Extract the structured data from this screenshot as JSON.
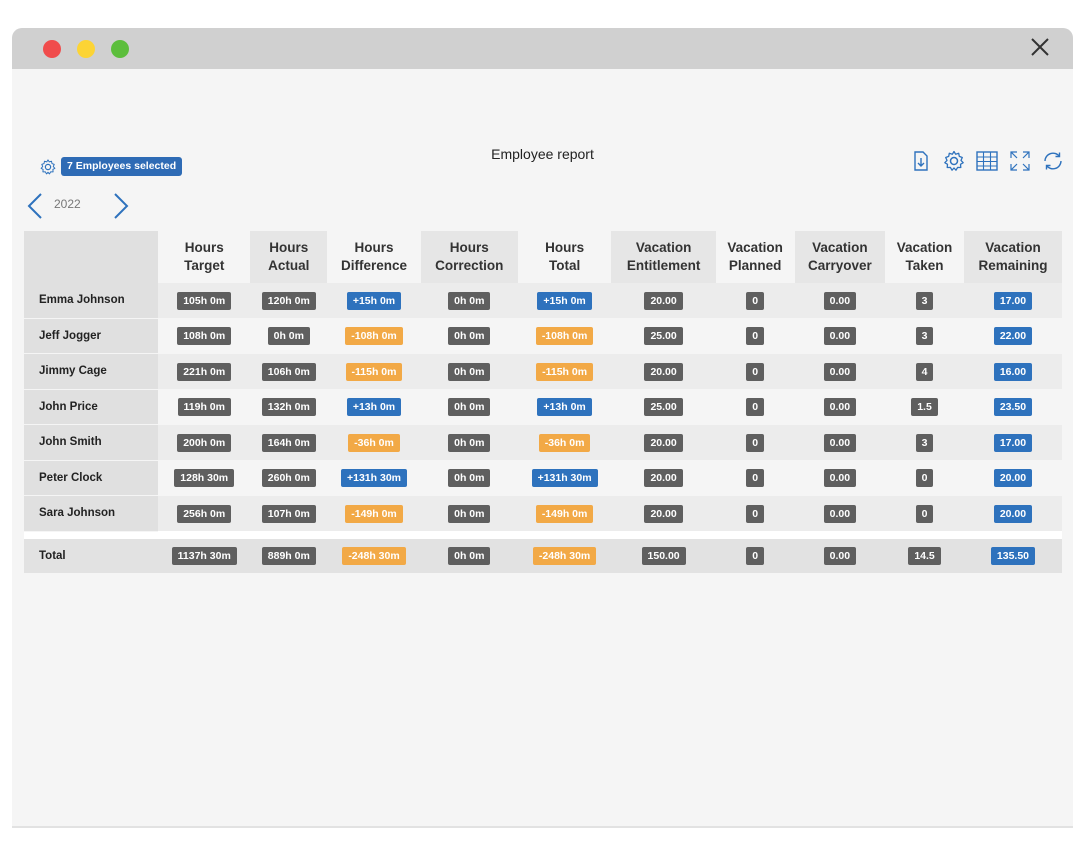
{
  "window": {
    "close_label": "close"
  },
  "header": {
    "title": "Employee report",
    "selection_badge": "7 Employees selected",
    "year": "2022",
    "toolbar": [
      "export-icon",
      "settings-icon",
      "table-view-icon",
      "fullscreen-icon",
      "refresh-icon"
    ]
  },
  "colors": {
    "gray": "#5f5f5f",
    "blue": "#2e72bd",
    "orange": "#f2a946",
    "accent": "#2e6bb5"
  },
  "table": {
    "columns": [
      {
        "l1": "Hours",
        "l2": "Target"
      },
      {
        "l1": "Hours",
        "l2": "Actual"
      },
      {
        "l1": "Hours",
        "l2": "Difference"
      },
      {
        "l1": "Hours",
        "l2": "Correction"
      },
      {
        "l1": "Hours",
        "l2": "Total"
      },
      {
        "l1": "Vacation",
        "l2": "Entitlement"
      },
      {
        "l1": "Vacation",
        "l2": "Planned"
      },
      {
        "l1": "Vacation",
        "l2": "Carryover"
      },
      {
        "l1": "Vacation",
        "l2": "Taken"
      },
      {
        "l1": "Vacation",
        "l2": "Remaining"
      }
    ],
    "rows": [
      {
        "name": "Emma Johnson",
        "cells": [
          {
            "v": "105h 0m",
            "c": "gray"
          },
          {
            "v": "120h 0m",
            "c": "gray"
          },
          {
            "v": "+15h 0m",
            "c": "blue"
          },
          {
            "v": "0h 0m",
            "c": "gray"
          },
          {
            "v": "+15h 0m",
            "c": "blue"
          },
          {
            "v": "20.00",
            "c": "gray"
          },
          {
            "v": "0",
            "c": "gray"
          },
          {
            "v": "0.00",
            "c": "gray"
          },
          {
            "v": "3",
            "c": "gray"
          },
          {
            "v": "17.00",
            "c": "blue"
          }
        ]
      },
      {
        "name": "Jeff Jogger",
        "cells": [
          {
            "v": "108h 0m",
            "c": "gray"
          },
          {
            "v": "0h 0m",
            "c": "gray"
          },
          {
            "v": "-108h 0m",
            "c": "orange"
          },
          {
            "v": "0h 0m",
            "c": "gray"
          },
          {
            "v": "-108h 0m",
            "c": "orange"
          },
          {
            "v": "25.00",
            "c": "gray"
          },
          {
            "v": "0",
            "c": "gray"
          },
          {
            "v": "0.00",
            "c": "gray"
          },
          {
            "v": "3",
            "c": "gray"
          },
          {
            "v": "22.00",
            "c": "blue"
          }
        ]
      },
      {
        "name": "Jimmy Cage",
        "cells": [
          {
            "v": "221h 0m",
            "c": "gray"
          },
          {
            "v": "106h 0m",
            "c": "gray"
          },
          {
            "v": "-115h 0m",
            "c": "orange"
          },
          {
            "v": "0h 0m",
            "c": "gray"
          },
          {
            "v": "-115h 0m",
            "c": "orange"
          },
          {
            "v": "20.00",
            "c": "gray"
          },
          {
            "v": "0",
            "c": "gray"
          },
          {
            "v": "0.00",
            "c": "gray"
          },
          {
            "v": "4",
            "c": "gray"
          },
          {
            "v": "16.00",
            "c": "blue"
          }
        ]
      },
      {
        "name": "John Price",
        "cells": [
          {
            "v": "119h 0m",
            "c": "gray"
          },
          {
            "v": "132h 0m",
            "c": "gray"
          },
          {
            "v": "+13h 0m",
            "c": "blue"
          },
          {
            "v": "0h 0m",
            "c": "gray"
          },
          {
            "v": "+13h 0m",
            "c": "blue"
          },
          {
            "v": "25.00",
            "c": "gray"
          },
          {
            "v": "0",
            "c": "gray"
          },
          {
            "v": "0.00",
            "c": "gray"
          },
          {
            "v": "1.5",
            "c": "gray"
          },
          {
            "v": "23.50",
            "c": "blue"
          }
        ]
      },
      {
        "name": "John Smith",
        "cells": [
          {
            "v": "200h 0m",
            "c": "gray"
          },
          {
            "v": "164h 0m",
            "c": "gray"
          },
          {
            "v": "-36h 0m",
            "c": "orange"
          },
          {
            "v": "0h 0m",
            "c": "gray"
          },
          {
            "v": "-36h 0m",
            "c": "orange"
          },
          {
            "v": "20.00",
            "c": "gray"
          },
          {
            "v": "0",
            "c": "gray"
          },
          {
            "v": "0.00",
            "c": "gray"
          },
          {
            "v": "3",
            "c": "gray"
          },
          {
            "v": "17.00",
            "c": "blue"
          }
        ]
      },
      {
        "name": "Peter Clock",
        "cells": [
          {
            "v": "128h 30m",
            "c": "gray"
          },
          {
            "v": "260h 0m",
            "c": "gray"
          },
          {
            "v": "+131h 30m",
            "c": "blue"
          },
          {
            "v": "0h 0m",
            "c": "gray"
          },
          {
            "v": "+131h 30m",
            "c": "blue"
          },
          {
            "v": "20.00",
            "c": "gray"
          },
          {
            "v": "0",
            "c": "gray"
          },
          {
            "v": "0.00",
            "c": "gray"
          },
          {
            "v": "0",
            "c": "gray"
          },
          {
            "v": "20.00",
            "c": "blue"
          }
        ]
      },
      {
        "name": "Sara Johnson",
        "cells": [
          {
            "v": "256h 0m",
            "c": "gray"
          },
          {
            "v": "107h 0m",
            "c": "gray"
          },
          {
            "v": "-149h 0m",
            "c": "orange"
          },
          {
            "v": "0h 0m",
            "c": "gray"
          },
          {
            "v": "-149h 0m",
            "c": "orange"
          },
          {
            "v": "20.00",
            "c": "gray"
          },
          {
            "v": "0",
            "c": "gray"
          },
          {
            "v": "0.00",
            "c": "gray"
          },
          {
            "v": "0",
            "c": "gray"
          },
          {
            "v": "20.00",
            "c": "blue"
          }
        ]
      }
    ],
    "total": {
      "name": "Total",
      "cells": [
        {
          "v": "1137h 30m",
          "c": "gray"
        },
        {
          "v": "889h 0m",
          "c": "gray"
        },
        {
          "v": "-248h 30m",
          "c": "orange"
        },
        {
          "v": "0h 0m",
          "c": "gray"
        },
        {
          "v": "-248h 30m",
          "c": "orange"
        },
        {
          "v": "150.00",
          "c": "gray"
        },
        {
          "v": "0",
          "c": "gray"
        },
        {
          "v": "0.00",
          "c": "gray"
        },
        {
          "v": "14.5",
          "c": "gray"
        },
        {
          "v": "135.50",
          "c": "blue"
        }
      ]
    }
  }
}
